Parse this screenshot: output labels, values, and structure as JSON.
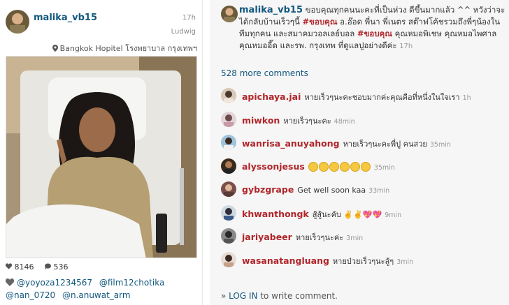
{
  "post": {
    "username": "malika_vb15",
    "time": "17h",
    "device": "Ludwig",
    "location": "Bangkok Hopitel โรงพยาบาล กรุงเทพฯ",
    "likes": "8146",
    "comments_count": "536",
    "likers": [
      "@yoyoza1234567",
      "@film12chotika",
      "@nan_0720",
      "@n.anuwat_arm"
    ]
  },
  "caption": {
    "username": "malika_vb15",
    "text_1": " ขอบคุณทุกคนนะคะที่เป็นห่วง ดีขึ้นมากแล้ว ^^ หวังว่าจะได้กลับบ้านเร็วๆนี้ ",
    "hashtag_1": "#ขอบคุณ",
    "text_2": " อ.อ๊อด พี่นา พี่เนตร สต๊าฟโค้ชรวมถึงพี่ๆน้องในทีมทุกคน และสมาคมวอลเลย์บอล ",
    "hashtag_2": "#ขอบคุณ",
    "text_3": " คุณหมอพิเชษ คุณหมอไพศาล คุณหมออี๊ด และรพ. กรุงเทพ ที่ดูแลปูอย่างดีค่ะ ",
    "time": "17h"
  },
  "more_comments": "528 more comments",
  "comments": [
    {
      "user": "apichaya.jai",
      "text": "หายเร็วๆนะคะชอบมากค่ะคุณคือที่หนึ่งในใจเรา",
      "time": "1h",
      "emojis": 0
    },
    {
      "user": "miwkon",
      "text": "หายเร็วๆนะคะ",
      "time": "48min",
      "emojis": 0
    },
    {
      "user": "wanrisa_anuyahong",
      "text": "หายเร็วๆนะคะพี่ปู คนสวย",
      "time": "35min",
      "emojis": 0
    },
    {
      "user": "alyssonjesus",
      "text": "",
      "time": "35min",
      "emojis": 6
    },
    {
      "user": "gybzgrape",
      "text": "Get well soon kaa",
      "time": "33min",
      "emojis": 0
    },
    {
      "user": "khwanthongk",
      "text": "สู้สู้นะคับ ✌️✌️💖💖",
      "time": "9min",
      "emojis": 0
    },
    {
      "user": "jariyabeer",
      "text": "หายเร็วๆนะค่ะ",
      "time": "3min",
      "emojis": 0
    },
    {
      "user": "wasanatangluang",
      "text": "หายป่วยเร็วๆนะสู้ๆ",
      "time": "3min",
      "emojis": 0
    }
  ],
  "login": {
    "prefix": "» ",
    "link": "LOG IN",
    "suffix": " to write comment."
  }
}
